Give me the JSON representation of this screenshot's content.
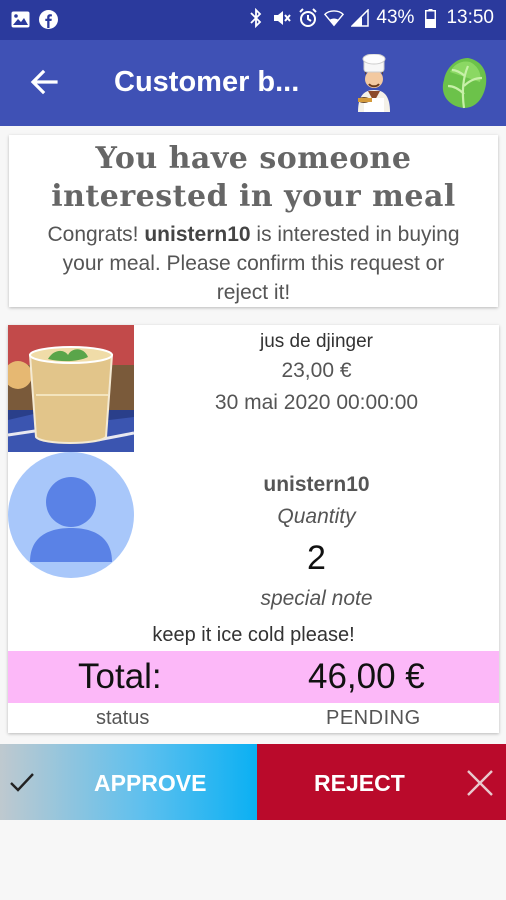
{
  "status_bar": {
    "battery": "43%",
    "time": "13:50",
    "icons": [
      "image-icon",
      "facebook-icon",
      "bluetooth-icon",
      "mute-icon",
      "alarm-icon",
      "wifi-icon",
      "signal-icon",
      "battery-icon"
    ]
  },
  "app_bar": {
    "title": "Customer b...",
    "icons": [
      "back-arrow-icon",
      "chef-icon",
      "lettuce-icon"
    ]
  },
  "intro": {
    "headline": "You have someone interested in your meal",
    "congrats_prefix": "Congrats! ",
    "username": "unistern10",
    "congrats_suffix": " is interested in buying your meal. Please confirm this request or reject it!"
  },
  "meal": {
    "name": "jus de djinger",
    "price": "23,00 €",
    "date": "30 mai 2020 00:00:00"
  },
  "buyer": {
    "username": "unistern10",
    "quantity_label": "Quantity",
    "quantity": "2",
    "note_label": "special note",
    "note": "keep it ice cold please!"
  },
  "order": {
    "total_label": "Total:",
    "total_value": "46,00 €",
    "status_label": "status",
    "status_value": "PENDING"
  },
  "actions": {
    "approve_label": "APPROVE",
    "reject_label": "REJECT"
  },
  "colors": {
    "status_bar": "#2b3a9d",
    "app_bar": "#3f51b5",
    "total_highlight": "#fcb8f8",
    "approve": "#0bb0f3",
    "reject": "#ba0a2b"
  }
}
